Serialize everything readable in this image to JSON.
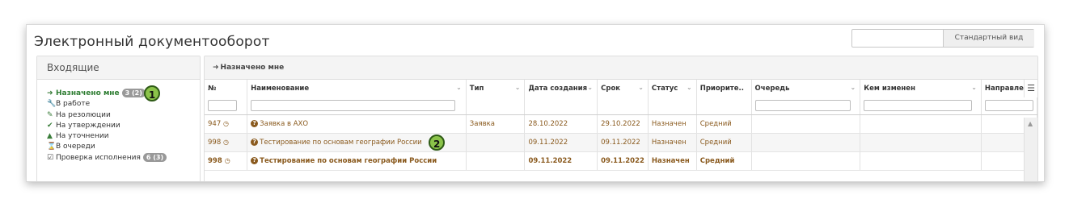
{
  "app": {
    "title": "Электронный документооборот"
  },
  "view_switcher": {
    "input_value": "",
    "button_label": "Стандартный вид"
  },
  "sidebar": {
    "header": "Входящие",
    "items": [
      {
        "icon": "sign-in-icon",
        "glyph": "➜",
        "label": "Назначено мне",
        "badge": "3 (2)",
        "active": true
      },
      {
        "icon": "wrench-icon",
        "glyph": "🔧",
        "label": "В работе"
      },
      {
        "icon": "pen-icon",
        "glyph": "✎",
        "label": "На резолюции"
      },
      {
        "icon": "check-circle-icon",
        "glyph": "✔",
        "label": "На утверждении"
      },
      {
        "icon": "warning-icon",
        "glyph": "▲",
        "label": "На уточнении"
      },
      {
        "icon": "hourglass-icon",
        "glyph": "⌛",
        "label": "В очереди"
      },
      {
        "icon": "checkbox-icon",
        "glyph": "☑",
        "label": "Проверка исполнения",
        "badge": "6 (3)"
      }
    ]
  },
  "markers": {
    "m1": "1",
    "m2": "2"
  },
  "main": {
    "header": "Назначено мне",
    "columns": [
      "№",
      "Наименование",
      "Тип",
      "Дата создания",
      "Срок",
      "Статус",
      "Приорите..",
      "Очередь",
      "Кем изменен",
      "Направле"
    ],
    "rows": [
      {
        "num": "947",
        "name": "Заявка в АХО",
        "type": "Заявка",
        "created": "28.10.2022",
        "due": "29.10.2022",
        "status": "Назначен",
        "priority": "Средний",
        "queue": "",
        "changed_by": "",
        "direction": ""
      },
      {
        "num": "998",
        "name": "Тестирование по основам географии России",
        "type": "",
        "created": "09.11.2022",
        "due": "09.11.2022",
        "status": "Назначен",
        "priority": "Средний",
        "queue": "",
        "changed_by": "",
        "direction": ""
      },
      {
        "num": "998",
        "name": "Тестирование по основам географии России",
        "type": "",
        "created": "09.11.2022",
        "due": "09.11.2022",
        "status": "Назначен",
        "priority": "Средний",
        "queue": "",
        "changed_by": "",
        "direction": ""
      }
    ]
  },
  "colors": {
    "accent_green": "#2e7d32",
    "link_brown": "#8a5a1e",
    "marker_green": "#8bc34a"
  }
}
